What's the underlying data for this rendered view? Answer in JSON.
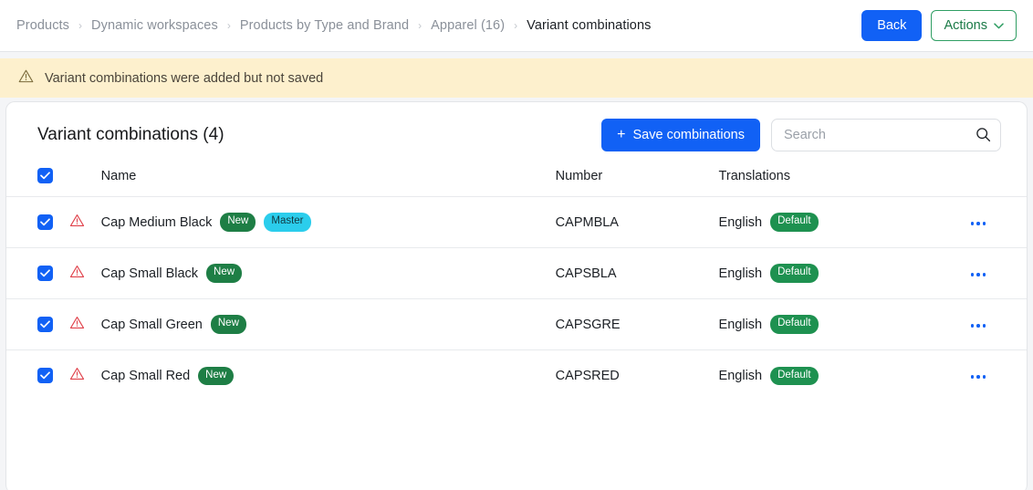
{
  "topbar": {
    "breadcrumb": [
      {
        "label": "Products",
        "current": false
      },
      {
        "label": "Dynamic workspaces",
        "current": false
      },
      {
        "label": "Products by Type and Brand",
        "current": false
      },
      {
        "label": "Apparel (16)",
        "current": false
      },
      {
        "label": "Variant combinations",
        "current": true
      }
    ],
    "separator": "›",
    "back_label": "Back",
    "actions_label": "Actions"
  },
  "banner": {
    "icon": "warning-triangle-icon",
    "message": "Variant combinations were added but not saved",
    "background": "#fdf0cd"
  },
  "card": {
    "title": "Variant combinations (4)",
    "save_label": "Save combinations",
    "save_plus": "+",
    "search": {
      "value": "",
      "placeholder": "Search"
    }
  },
  "table": {
    "select_all_checked": true,
    "columns": [
      "",
      "",
      "Name",
      "Number",
      "Translations",
      ""
    ],
    "headers": {
      "name": "Name",
      "number": "Number",
      "translations": "Translations"
    },
    "rows": [
      {
        "checked": true,
        "warning": true,
        "name": "Cap Medium Black",
        "badges": [
          {
            "label": "New",
            "style": "new"
          },
          {
            "label": "Master",
            "style": "master"
          }
        ],
        "number": "CAPMBLA",
        "translation": "English",
        "translation_badge": "Default",
        "menu": "…"
      },
      {
        "checked": true,
        "warning": true,
        "name": "Cap Small Black",
        "badges": [
          {
            "label": "New",
            "style": "new"
          }
        ],
        "number": "CAPSBLA",
        "translation": "English",
        "translation_badge": "Default",
        "menu": "…"
      },
      {
        "checked": true,
        "warning": true,
        "name": "Cap Small Green",
        "badges": [
          {
            "label": "New",
            "style": "new"
          }
        ],
        "number": "CAPSGRE",
        "translation": "English",
        "translation_badge": "Default",
        "menu": "…"
      },
      {
        "checked": true,
        "warning": true,
        "name": "Cap Small Red",
        "badges": [
          {
            "label": "New",
            "style": "new"
          }
        ],
        "number": "CAPSRED",
        "translation": "English",
        "translation_badge": "Default",
        "menu": "…"
      }
    ]
  },
  "colors": {
    "primary_blue": "#1161f5",
    "action_green": "#2f9e63",
    "badge_new_green": "#1e7e45",
    "badge_master_cyan": "#2bcdec",
    "badge_default_green": "#1e9150",
    "warning_red": "#e0414a",
    "banner_yellow": "#fdf0cd",
    "page_background": "#f4f5f7"
  }
}
